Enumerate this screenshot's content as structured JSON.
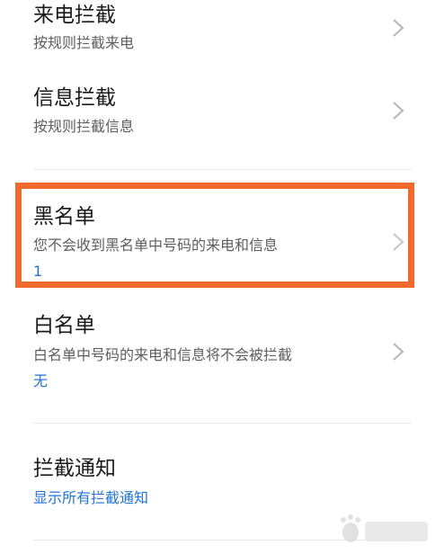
{
  "items": [
    {
      "title": "来电拦截",
      "subtitle": "按规则拦截来电",
      "value": ""
    },
    {
      "title": "信息拦截",
      "subtitle": "按规则拦截信息",
      "value": ""
    },
    {
      "title": "黑名单",
      "subtitle": "您不会收到黑名单中号码的来电和信息",
      "value": "1"
    },
    {
      "title": "白名单",
      "subtitle": "白名单中号码的来电和信息将不会被拦截",
      "value": "无"
    },
    {
      "title": "拦截通知",
      "subtitle": "",
      "value": "显示所有拦截通知"
    }
  ],
  "colors": {
    "highlight": "#f06a2d",
    "value_text": "#1f72d6",
    "title_text": "#1a1a1a",
    "subtitle_text": "#5e5e5e"
  },
  "icons": {
    "chevron": "chevron-right-icon",
    "watermark": "baidu-jingyan-logo"
  }
}
